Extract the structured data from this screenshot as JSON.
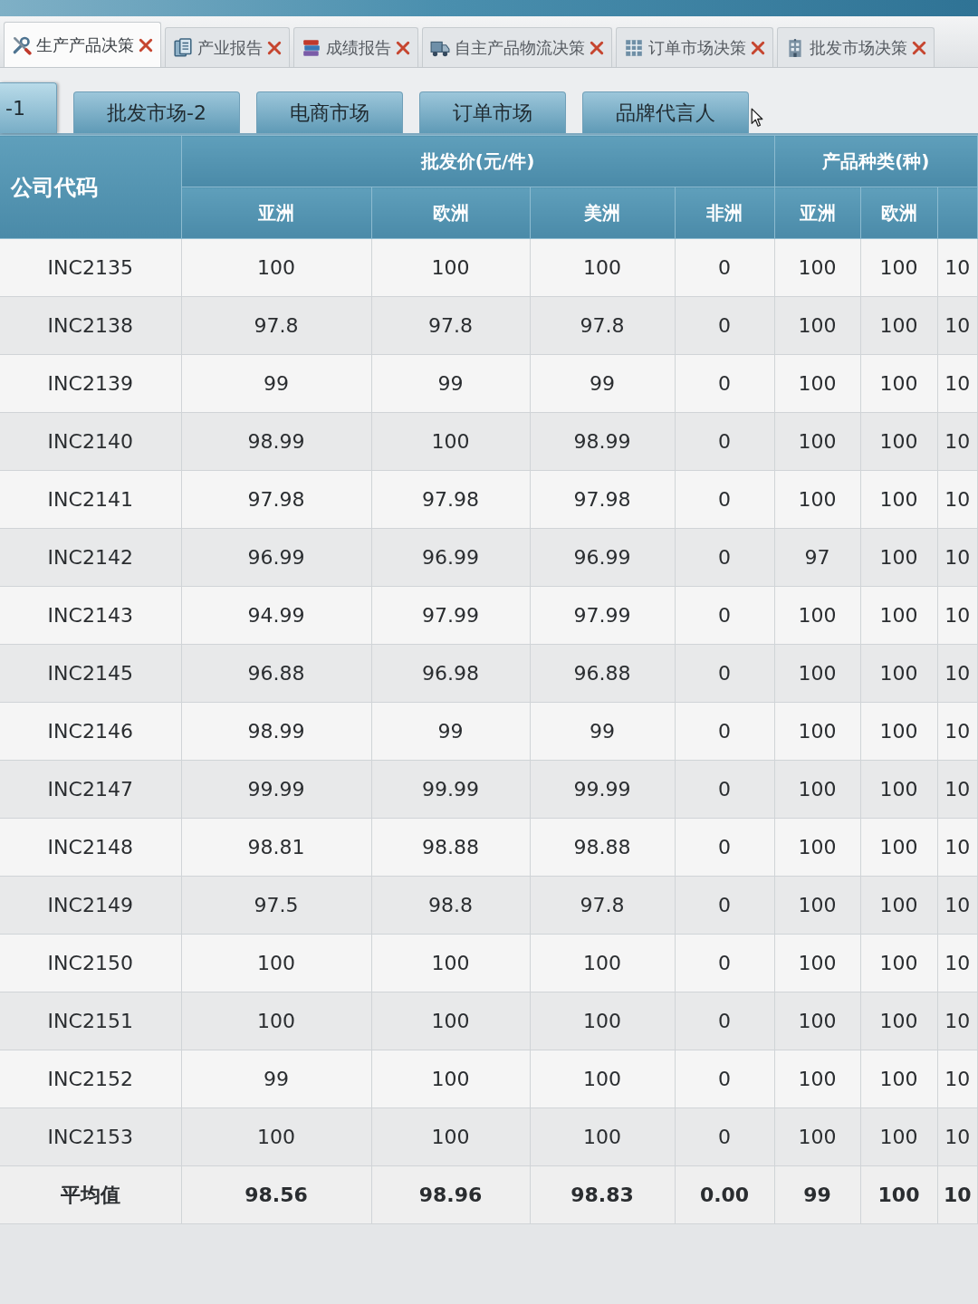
{
  "top_tabs": [
    {
      "label": "生产产品决策",
      "selected": true
    },
    {
      "label": "产业报告",
      "selected": false
    },
    {
      "label": "成绩报告",
      "selected": false
    },
    {
      "label": "自主产品物流决策",
      "selected": false
    },
    {
      "label": "订单市场决策",
      "selected": false
    },
    {
      "label": "批发市场决策",
      "selected": false
    }
  ],
  "market_tabs": [
    {
      "label": "-1",
      "selected": true
    },
    {
      "label": "批发市场-2",
      "selected": false
    },
    {
      "label": "电商市场",
      "selected": false
    },
    {
      "label": "订单市场",
      "selected": false
    },
    {
      "label": "品牌代言人",
      "selected": false
    }
  ],
  "table": {
    "first_column": "公司代码",
    "groups": [
      {
        "label": "批发价(元/件)",
        "columns": [
          "亚洲",
          "欧洲",
          "美洲",
          "非洲"
        ]
      },
      {
        "label": "产品种类(种)",
        "columns": [
          "亚洲",
          "欧洲"
        ]
      }
    ],
    "rows": [
      {
        "code": "INC2135",
        "cells": [
          "100",
          "100",
          "100",
          "0",
          "100",
          "100",
          "10"
        ]
      },
      {
        "code": "INC2138",
        "cells": [
          "97.8",
          "97.8",
          "97.8",
          "0",
          "100",
          "100",
          "10"
        ]
      },
      {
        "code": "INC2139",
        "cells": [
          "99",
          "99",
          "99",
          "0",
          "100",
          "100",
          "10"
        ]
      },
      {
        "code": "INC2140",
        "cells": [
          "98.99",
          "100",
          "98.99",
          "0",
          "100",
          "100",
          "10"
        ]
      },
      {
        "code": "INC2141",
        "cells": [
          "97.98",
          "97.98",
          "97.98",
          "0",
          "100",
          "100",
          "10"
        ]
      },
      {
        "code": "INC2142",
        "cells": [
          "96.99",
          "96.99",
          "96.99",
          "0",
          "97",
          "100",
          "10"
        ]
      },
      {
        "code": "INC2143",
        "cells": [
          "94.99",
          "97.99",
          "97.99",
          "0",
          "100",
          "100",
          "10"
        ]
      },
      {
        "code": "INC2145",
        "cells": [
          "96.88",
          "96.98",
          "96.88",
          "0",
          "100",
          "100",
          "10"
        ]
      },
      {
        "code": "INC2146",
        "cells": [
          "98.99",
          "99",
          "99",
          "0",
          "100",
          "100",
          "10"
        ]
      },
      {
        "code": "INC2147",
        "cells": [
          "99.99",
          "99.99",
          "99.99",
          "0",
          "100",
          "100",
          "10"
        ]
      },
      {
        "code": "INC2148",
        "cells": [
          "98.81",
          "98.88",
          "98.88",
          "0",
          "100",
          "100",
          "10"
        ]
      },
      {
        "code": "INC2149",
        "cells": [
          "97.5",
          "98.8",
          "97.8",
          "0",
          "100",
          "100",
          "10"
        ]
      },
      {
        "code": "INC2150",
        "cells": [
          "100",
          "100",
          "100",
          "0",
          "100",
          "100",
          "10"
        ]
      },
      {
        "code": "INC2151",
        "cells": [
          "100",
          "100",
          "100",
          "0",
          "100",
          "100",
          "10"
        ]
      },
      {
        "code": "INC2152",
        "cells": [
          "99",
          "100",
          "100",
          "0",
          "100",
          "100",
          "10"
        ]
      },
      {
        "code": "INC2153",
        "cells": [
          "100",
          "100",
          "100",
          "0",
          "100",
          "100",
          "10"
        ]
      }
    ],
    "average": {
      "label": "平均值",
      "cells": [
        "98.56",
        "98.96",
        "98.83",
        "0.00",
        "99",
        "100",
        "10"
      ]
    }
  }
}
